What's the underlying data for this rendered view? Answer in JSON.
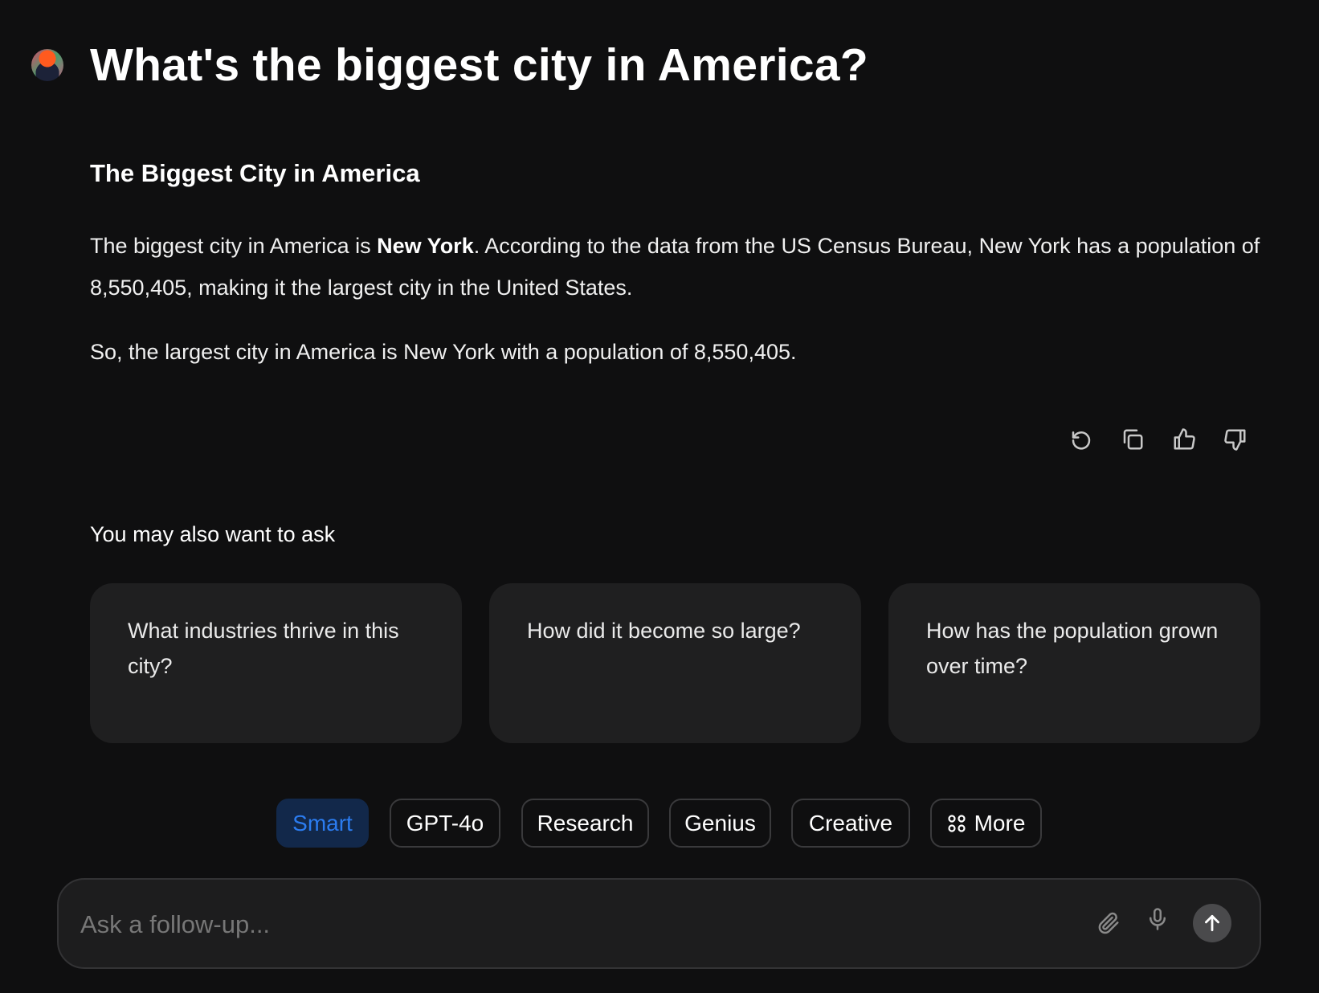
{
  "question": "What's the biggest city in America?",
  "answer": {
    "heading": "The Biggest City in America",
    "p1_before": "The biggest city in America is ",
    "p1_bold": "New York",
    "p1_after": ". According to the data from the US Census Bureau, New York has a population of 8,550,405, making it the largest city in the United States.",
    "p2": "So, the largest city in America is New York with a population of 8,550,405."
  },
  "actions": [
    "regenerate-icon",
    "copy-icon",
    "thumbs-up-icon",
    "thumbs-down-icon"
  ],
  "suggestions": {
    "label": "You may also want to ask",
    "items": [
      "What industries thrive in this city?",
      "How did it become so large?",
      "How has the population grown over time?"
    ]
  },
  "modes": {
    "items": [
      "Smart",
      "GPT-4o",
      "Research",
      "Genius",
      "Creative",
      "More"
    ],
    "selected": "Smart",
    "accent": "#2b7cf0"
  },
  "composer": {
    "placeholder": "Ask a follow-up..."
  }
}
